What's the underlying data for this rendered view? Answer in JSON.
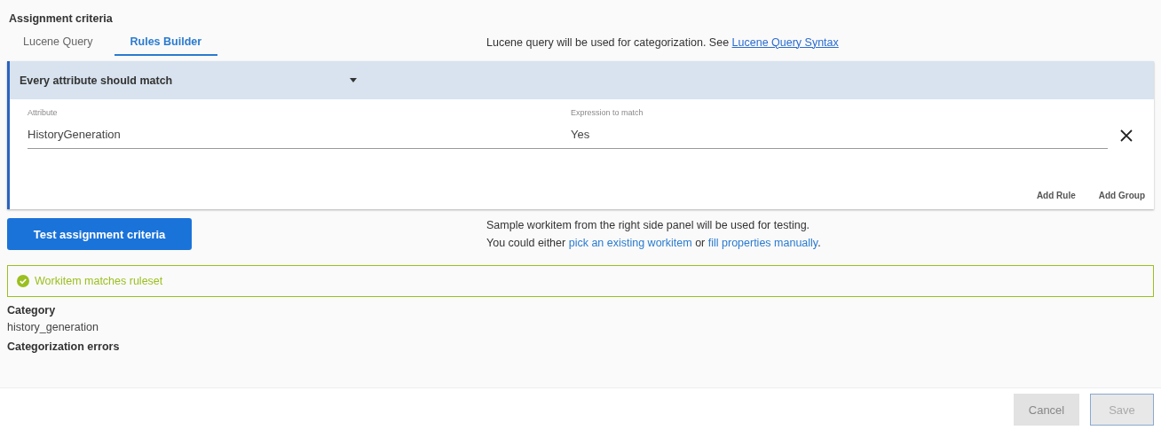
{
  "section_title": "Assignment criteria",
  "tabs": [
    {
      "label": "Lucene Query",
      "selected": false
    },
    {
      "label": "Rules Builder",
      "selected": true
    }
  ],
  "hint": {
    "text": "Lucene query will be used for categorization. See",
    "link": "Lucene Query Syntax"
  },
  "group": {
    "match_mode": "Every attribute should match",
    "rules": [
      {
        "attribute_label": "Attribute",
        "attribute": "HistoryGeneration",
        "expression_label": "Expression to match",
        "expression": "Yes"
      }
    ],
    "actions": [
      "Add Rule",
      "Add Group"
    ]
  },
  "test_button": "Test assignment criteria",
  "test_hint": {
    "line_1": "Sample workitem from the right side panel will be used for testing.",
    "line_2_prefix": "You could either",
    "link_1": "pick an existing workitem",
    "joiner": "or",
    "link_2": "fill properties manually",
    "suffix": "."
  },
  "result": {
    "matched": true,
    "text": "Workitem matches ruleset"
  },
  "category_label": "Category",
  "category_value": "history_generation",
  "errors_label": "Categorization errors",
  "footer": [
    {
      "label": "Cancel",
      "disabled": true
    },
    {
      "label": "Save",
      "disabled": true
    }
  ]
}
